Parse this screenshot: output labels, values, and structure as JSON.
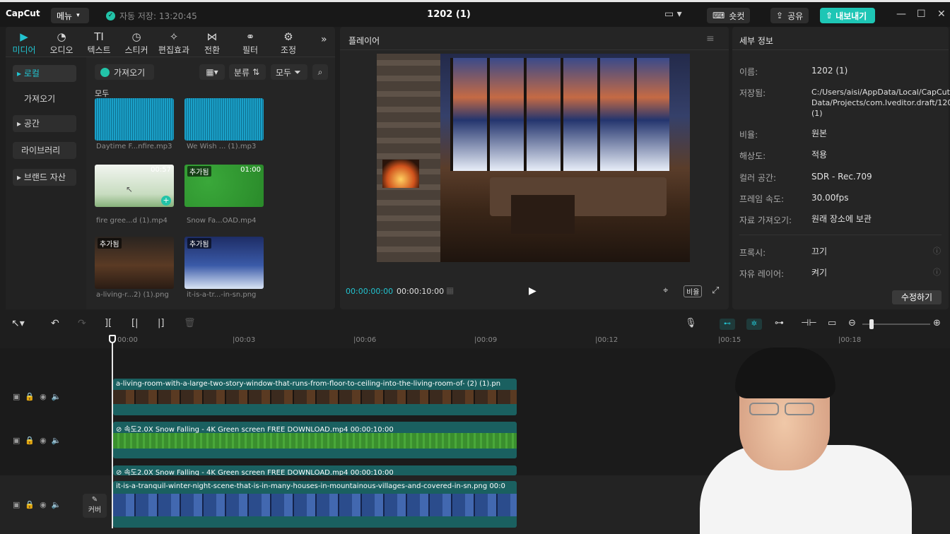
{
  "titlebar": {
    "logo": "CapCut",
    "menu": "메뉴",
    "autosave": "자동 저장: 13:20:45",
    "project": "1202 (1)",
    "shortcut": "숏컷",
    "share": "공유",
    "export": "내보내기"
  },
  "tabs": [
    "미디어",
    "오디오",
    "텍스트",
    "스티커",
    "편집효과",
    "전환",
    "필터",
    "조정"
  ],
  "tab_icons": [
    "play-box-icon",
    "audio-icon",
    "text-icon",
    "sticker-icon",
    "effect-star-icon",
    "transition-icon",
    "filter-icon",
    "adjust-icon"
  ],
  "sidebar": {
    "local": "▸ 로컬",
    "import": "가져오기",
    "space": "▸ 공간",
    "library": "라이브러리",
    "brand": "▸ 브랜드 자산"
  },
  "media_toolbar": {
    "import": "가져오기",
    "sort": "분류",
    "all": "모두"
  },
  "media_section": "모두",
  "media": [
    {
      "name": "Daytime F...nfire.mp3"
    },
    {
      "name": "We Wish ... (1).mp3"
    },
    {
      "name": "fire gree...d (1).mp4",
      "duration": "00:57"
    },
    {
      "name": "Snow Fa...OAD.mp4",
      "duration": "01:00",
      "badge": "추가됨"
    },
    {
      "name": "a-living-r...2) (1).png",
      "badge": "추가됨"
    },
    {
      "name": "it-is-a-tr...-in-sn.png",
      "badge": "추가됨"
    }
  ],
  "player": {
    "title": "플레이어",
    "current": "00:00:00:00",
    "total": "00:00:10:00",
    "ratio": "비율"
  },
  "details": {
    "title": "세부 정보",
    "rows": [
      {
        "label": "이름:",
        "value": "1202 (1)"
      },
      {
        "label": "저장됨:",
        "value": "C:/Users/aisi/AppData/Local/CapCut/User Data/Projects/com.lveditor.draft/1202 (1)"
      },
      {
        "label": "비율:",
        "value": "원본"
      },
      {
        "label": "해상도:",
        "value": "적용"
      },
      {
        "label": "컬러 공간:",
        "value": "SDR - Rec.709"
      },
      {
        "label": "프레임 속도:",
        "value": "30.00fps"
      },
      {
        "label": "자료 가져오기:",
        "value": "원래 장소에 보관"
      }
    ],
    "proxy_label": "프록시:",
    "proxy_value": "끄기",
    "layer_label": "자유 레이어:",
    "layer_value": "켜기",
    "edit": "수정하기"
  },
  "ruler": [
    "00:00",
    "|00:03",
    "|00:06",
    "|00:09",
    "|00:12",
    "|00:15",
    "|00:18"
  ],
  "clips": {
    "c1": "a-living-room-with-a-large-two-story-window-that-runs-from-floor-to-ceiling-into-the-living-room-of-  (2) (1).pn",
    "c2": "⊘ 속도2.0X  Snow Falling - 4K Green screen FREE DOWNLOAD.mp4  00:00:10:00",
    "c3": "⊘ 속도2.0X  Snow Falling - 4K Green screen FREE DOWNLOAD.mp4  00:00:10:00",
    "c4": "it-is-a-tranquil-winter-night-scene-that-is-in-many-houses-in-mountainous-villages-and-covered-in-sn.png  00:0"
  },
  "cover": "커버"
}
